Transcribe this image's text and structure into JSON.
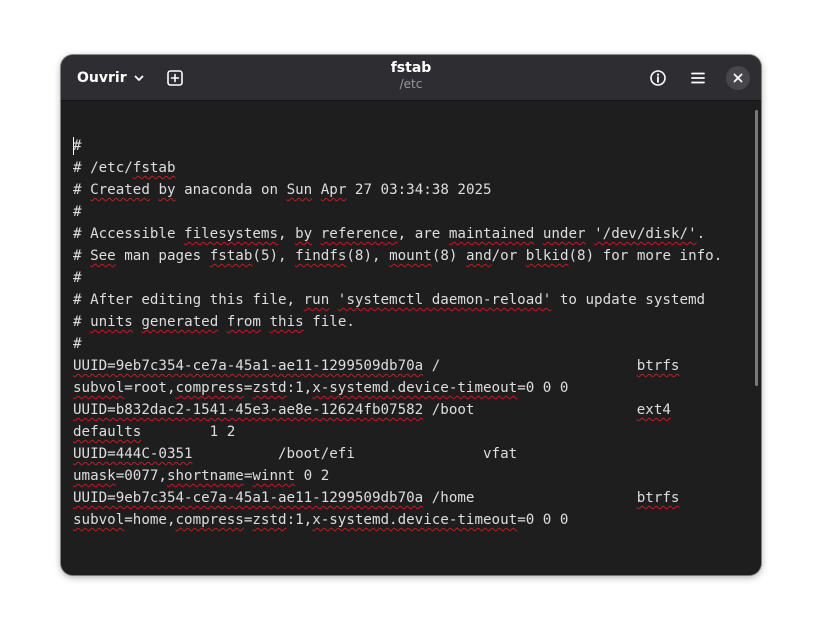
{
  "window": {
    "title": "fstab",
    "subtitle": "/etc"
  },
  "headerbar": {
    "open_label": "Ouvrir",
    "icons": {
      "open_dropdown": "chevron-down-icon",
      "new_tab": "tab-new-icon",
      "info": "info-icon",
      "menu": "hamburger-menu-icon",
      "close": "close-icon"
    }
  },
  "colors": {
    "background": "#1e1e1e",
    "headerbar": "#2e2e32",
    "text": "#dedede",
    "spellcheck_underline": "#c01c28"
  },
  "editor": {
    "lines": [
      [
        {
          "t": "#"
        }
      ],
      [
        {
          "t": "# /etc/"
        },
        {
          "t": "fstab",
          "s": true
        }
      ],
      [
        {
          "t": "# "
        },
        {
          "t": "Created",
          "s": true
        },
        {
          "t": " "
        },
        {
          "t": "by",
          "s": true
        },
        {
          "t": " anaconda on "
        },
        {
          "t": "Sun",
          "s": true
        },
        {
          "t": " "
        },
        {
          "t": "Apr",
          "s": true
        },
        {
          "t": " 27 03:34:38 2025"
        }
      ],
      [
        {
          "t": "#"
        }
      ],
      [
        {
          "t": "# Accessible "
        },
        {
          "t": "filesystems",
          "s": true
        },
        {
          "t": ", "
        },
        {
          "t": "by",
          "s": true
        },
        {
          "t": " "
        },
        {
          "t": "reference",
          "s": true
        },
        {
          "t": ", are "
        },
        {
          "t": "maintained",
          "s": true
        },
        {
          "t": " "
        },
        {
          "t": "under",
          "s": true
        },
        {
          "t": " "
        },
        {
          "t": "'/dev/disk/'",
          "s": true
        },
        {
          "t": "."
        }
      ],
      [
        {
          "t": "# "
        },
        {
          "t": "See",
          "s": true
        },
        {
          "t": " man pages "
        },
        {
          "t": "fstab",
          "s": true
        },
        {
          "t": "(5), "
        },
        {
          "t": "findfs",
          "s": true
        },
        {
          "t": "(8), "
        },
        {
          "t": "mount",
          "s": true
        },
        {
          "t": "(8) "
        },
        {
          "t": "and",
          "s": true
        },
        {
          "t": "/or "
        },
        {
          "t": "blkid",
          "s": true
        },
        {
          "t": "(8) for more info."
        }
      ],
      [
        {
          "t": "#"
        }
      ],
      [
        {
          "t": "# After editing this file, "
        },
        {
          "t": "run",
          "s": true
        },
        {
          "t": " "
        },
        {
          "t": "'systemctl daemon-reload'",
          "s": true
        },
        {
          "t": " to update systemd"
        }
      ],
      [
        {
          "t": "# "
        },
        {
          "t": "units",
          "s": true
        },
        {
          "t": " "
        },
        {
          "t": "generated",
          "s": true
        },
        {
          "t": " "
        },
        {
          "t": "from",
          "s": true
        },
        {
          "t": " "
        },
        {
          "t": "this",
          "s": true
        },
        {
          "t": " file."
        }
      ],
      [
        {
          "t": "#"
        }
      ],
      [
        {
          "t": "UUID=9eb7c354-ce7a-45a1-ae11-1299509db70a",
          "s": true
        },
        {
          "t": " /                       "
        },
        {
          "t": "btrfs",
          "s": true
        }
      ],
      [
        {
          "t": "subvol",
          "s": true
        },
        {
          "t": "=root,"
        },
        {
          "t": "compress",
          "s": true
        },
        {
          "t": "="
        },
        {
          "t": "zstd",
          "s": true
        },
        {
          "t": ":1,"
        },
        {
          "t": "x-systemd.device-timeout",
          "s": true
        },
        {
          "t": "=0 0 0"
        }
      ],
      [
        {
          "t": "UUID=b832dac2-1541-45e3-ae8e-12624fb07582",
          "s": true
        },
        {
          "t": " /boot                   "
        },
        {
          "t": "ext4",
          "s": true
        }
      ],
      [
        {
          "t": "defaults",
          "s": true
        },
        {
          "t": "        1 2"
        }
      ],
      [
        {
          "t": "UUID=444C-0351",
          "s": true
        },
        {
          "t": "          /boot/efi               vfat"
        }
      ],
      [
        {
          "t": "umask",
          "s": true
        },
        {
          "t": "=0077,"
        },
        {
          "t": "shortname",
          "s": true
        },
        {
          "t": "="
        },
        {
          "t": "winnt",
          "s": true
        },
        {
          "t": " 0 2"
        }
      ],
      [
        {
          "t": "UUID=9eb7c354-ce7a-45a1-ae11-1299509db70a",
          "s": true
        },
        {
          "t": " /home                   "
        },
        {
          "t": "btrfs",
          "s": true
        }
      ],
      [
        {
          "t": "subvol",
          "s": true
        },
        {
          "t": "=home,"
        },
        {
          "t": "compress",
          "s": true
        },
        {
          "t": "="
        },
        {
          "t": "zstd",
          "s": true
        },
        {
          "t": ":1,"
        },
        {
          "t": "x-systemd.device-timeout",
          "s": true
        },
        {
          "t": "=0 0 0"
        }
      ]
    ]
  }
}
